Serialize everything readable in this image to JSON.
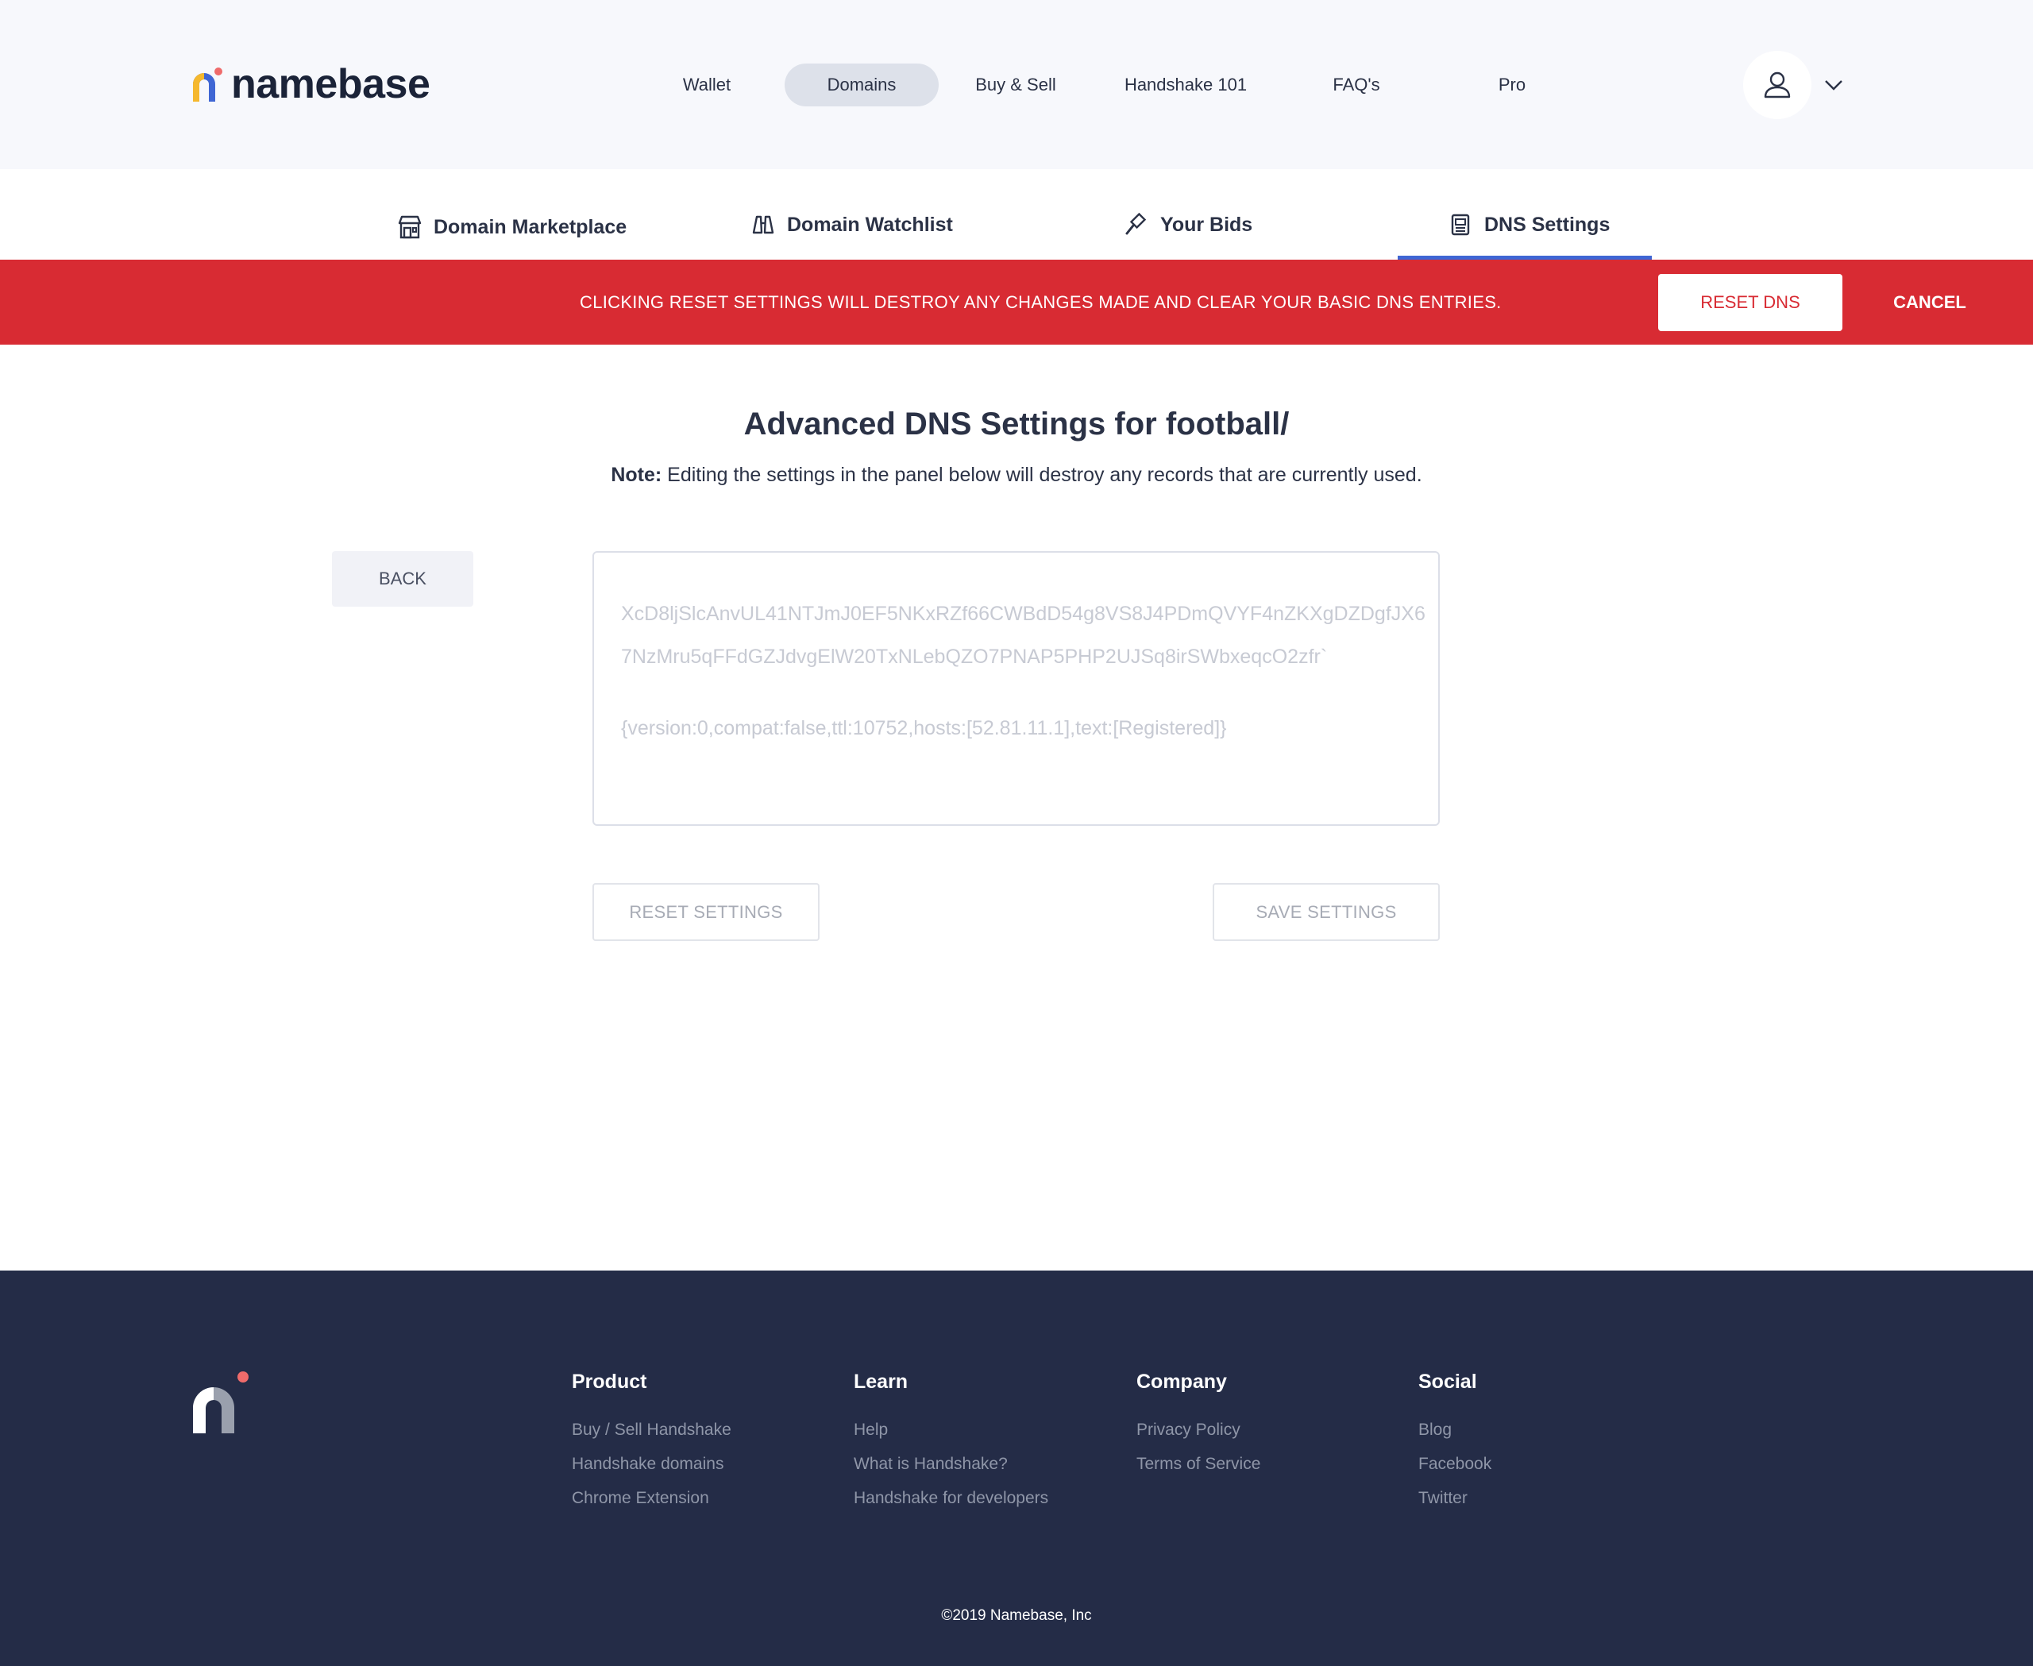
{
  "brand": {
    "name": "namebase",
    "colors": {
      "yellow": "#f5b82e",
      "blue": "#3f66d4",
      "red": "#d82b33"
    }
  },
  "nav": {
    "items": [
      {
        "label": "Wallet",
        "active": false
      },
      {
        "label": "Domains",
        "active": true
      },
      {
        "label": "Buy & Sell",
        "active": false
      },
      {
        "label": "Handshake 101",
        "active": false
      },
      {
        "label": "FAQ's",
        "active": false
      },
      {
        "label": "Pro",
        "active": false
      }
    ],
    "user_icon": "user-icon",
    "menu_icon": "chevron-down-icon"
  },
  "subtabs": [
    {
      "label": "Domain Marketplace",
      "icon": "store-icon"
    },
    {
      "label": "Domain Watchlist",
      "icon": "binoculars-icon"
    },
    {
      "label": "Your Bids",
      "icon": "gavel-icon"
    },
    {
      "label": "DNS Settings",
      "icon": "document-icon",
      "active": true
    }
  ],
  "alert": {
    "message": "CLICKING RESET SETTINGS WILL DESTROY ANY CHANGES MADE AND CLEAR YOUR BASIC DNS ENTRIES.",
    "reset_label": "RESET DNS",
    "cancel_label": "CANCEL"
  },
  "main": {
    "title": "Advanced DNS Settings for football/",
    "note_label": "Note:",
    "note_text": " Editing the settings in the panel below will destroy any records that are currently used.",
    "back_label": "BACK",
    "dns_line1": "XcD8ljSlcAnvUL41NTJmJ0EF5NKxRZf66CWBdD54g8VS8J4PDmQVYF4nZKXgDZDgfJX6",
    "dns_line2": "7NzMru5qFFdGZJdvgElW20TxNLebQZO7PNAP5PHP2UJSq8irSWbxeqcO2zfr`",
    "dns_line3": "{version:0,compat:false,ttl:10752,hosts:[52.81.11.1],text:[Registered]}",
    "reset_settings_label": "RESET SETTINGS",
    "save_settings_label": "SAVE SETTINGS"
  },
  "footer": {
    "columns": [
      {
        "title": "Product",
        "links": [
          "Buy / Sell Handshake",
          "Handshake domains",
          "Chrome Extension"
        ]
      },
      {
        "title": "Learn",
        "links": [
          "Help",
          "What is Handshake?",
          "Handshake for developers"
        ]
      },
      {
        "title": "Company",
        "links": [
          "Privacy Policy",
          "Terms of Service"
        ]
      },
      {
        "title": "Social",
        "links": [
          "Blog",
          "Facebook",
          "Twitter"
        ]
      }
    ],
    "copyright": "©2019 Namebase, Inc"
  }
}
